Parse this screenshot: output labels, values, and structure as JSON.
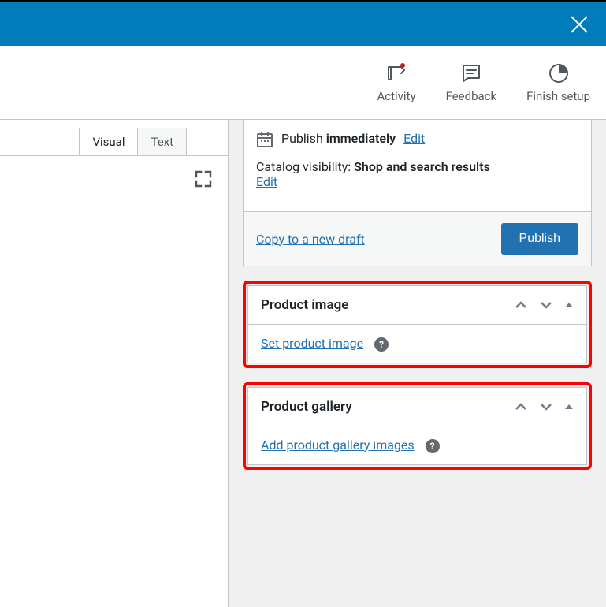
{
  "toolbar": {
    "activity": "Activity",
    "feedback": "Feedback",
    "finish_setup": "Finish setup"
  },
  "editor": {
    "tab_visual": "Visual",
    "tab_text": "Text"
  },
  "publish_panel": {
    "publish_label": "Publish",
    "immediately": "immediately",
    "edit": "Edit",
    "catalog_label": "Catalog visibility:",
    "catalog_value": "Shop and search results",
    "copy_draft": "Copy to a new draft",
    "publish_btn": "Publish"
  },
  "product_image": {
    "title": "Product image",
    "link": "Set product image"
  },
  "product_gallery": {
    "title": "Product gallery",
    "link": "Add product gallery images"
  }
}
